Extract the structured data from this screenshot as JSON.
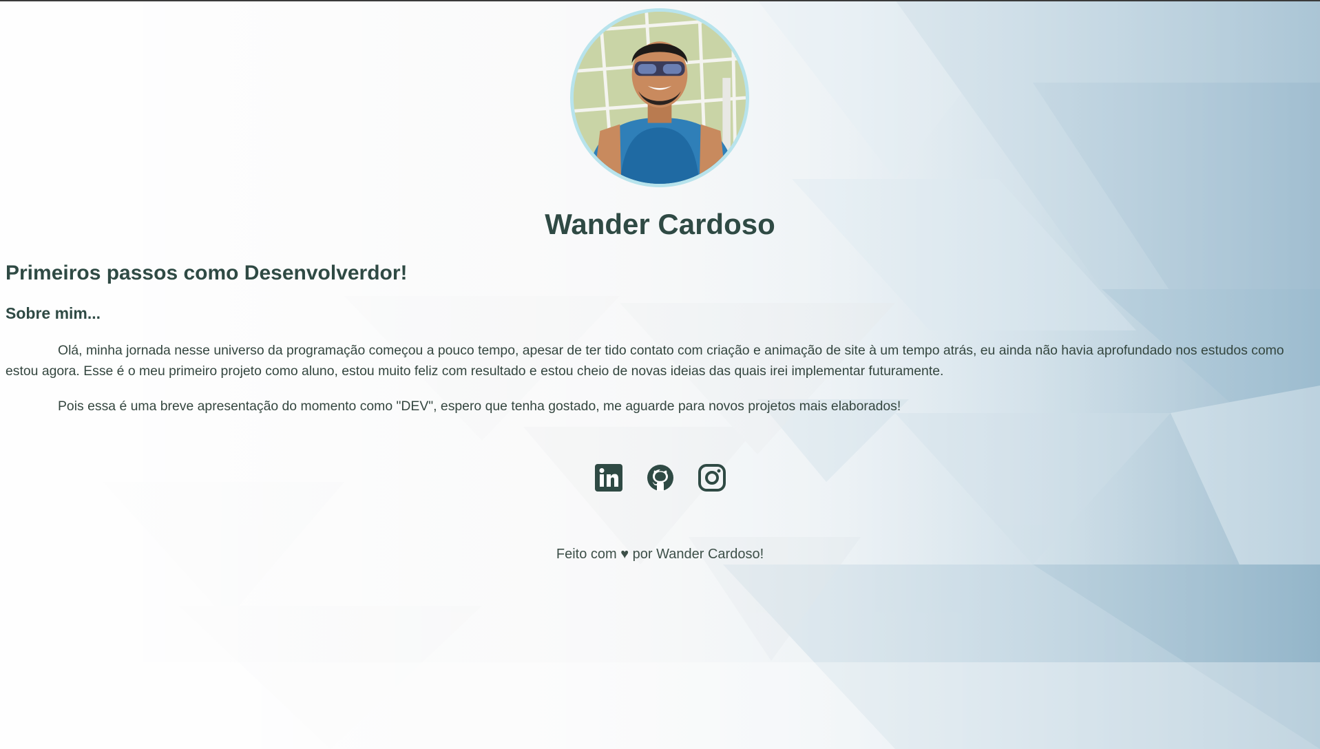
{
  "profile": {
    "name": "Wander Cardoso",
    "photo_alt": "Foto de perfil"
  },
  "main": {
    "headline": "Primeiros passos como Desenvolverdor!",
    "about_title": "Sobre mim...",
    "paragraphs": [
      "Olá, minha jornada nesse universo da programação começou a pouco tempo, apesar de ter tido contato com criação e animação de site à um tempo atrás, eu ainda não havia aprofundado nos estudos como estou agora. Esse é o meu primeiro projeto como aluno, estou muito feliz com resultado e estou cheio de novas ideias das quais irei implementar futuramente.",
      "Pois essa é uma breve apresentação do momento como \"DEV\", espero que tenha gostado, me aguarde para novos projetos mais elaborados!"
    ]
  },
  "social": {
    "items": [
      {
        "name": "LinkedIn",
        "icon": "linkedin-icon"
      },
      {
        "name": "GitHub",
        "icon": "github-icon"
      },
      {
        "name": "Instagram",
        "icon": "instagram-icon"
      }
    ]
  },
  "footer": {
    "text": "Feito com ♥ por Wander Cardoso!"
  },
  "colors": {
    "text": "#2f4a44",
    "avatar_border": "#b7e3ec",
    "background_accent": "#8fb3c8"
  }
}
